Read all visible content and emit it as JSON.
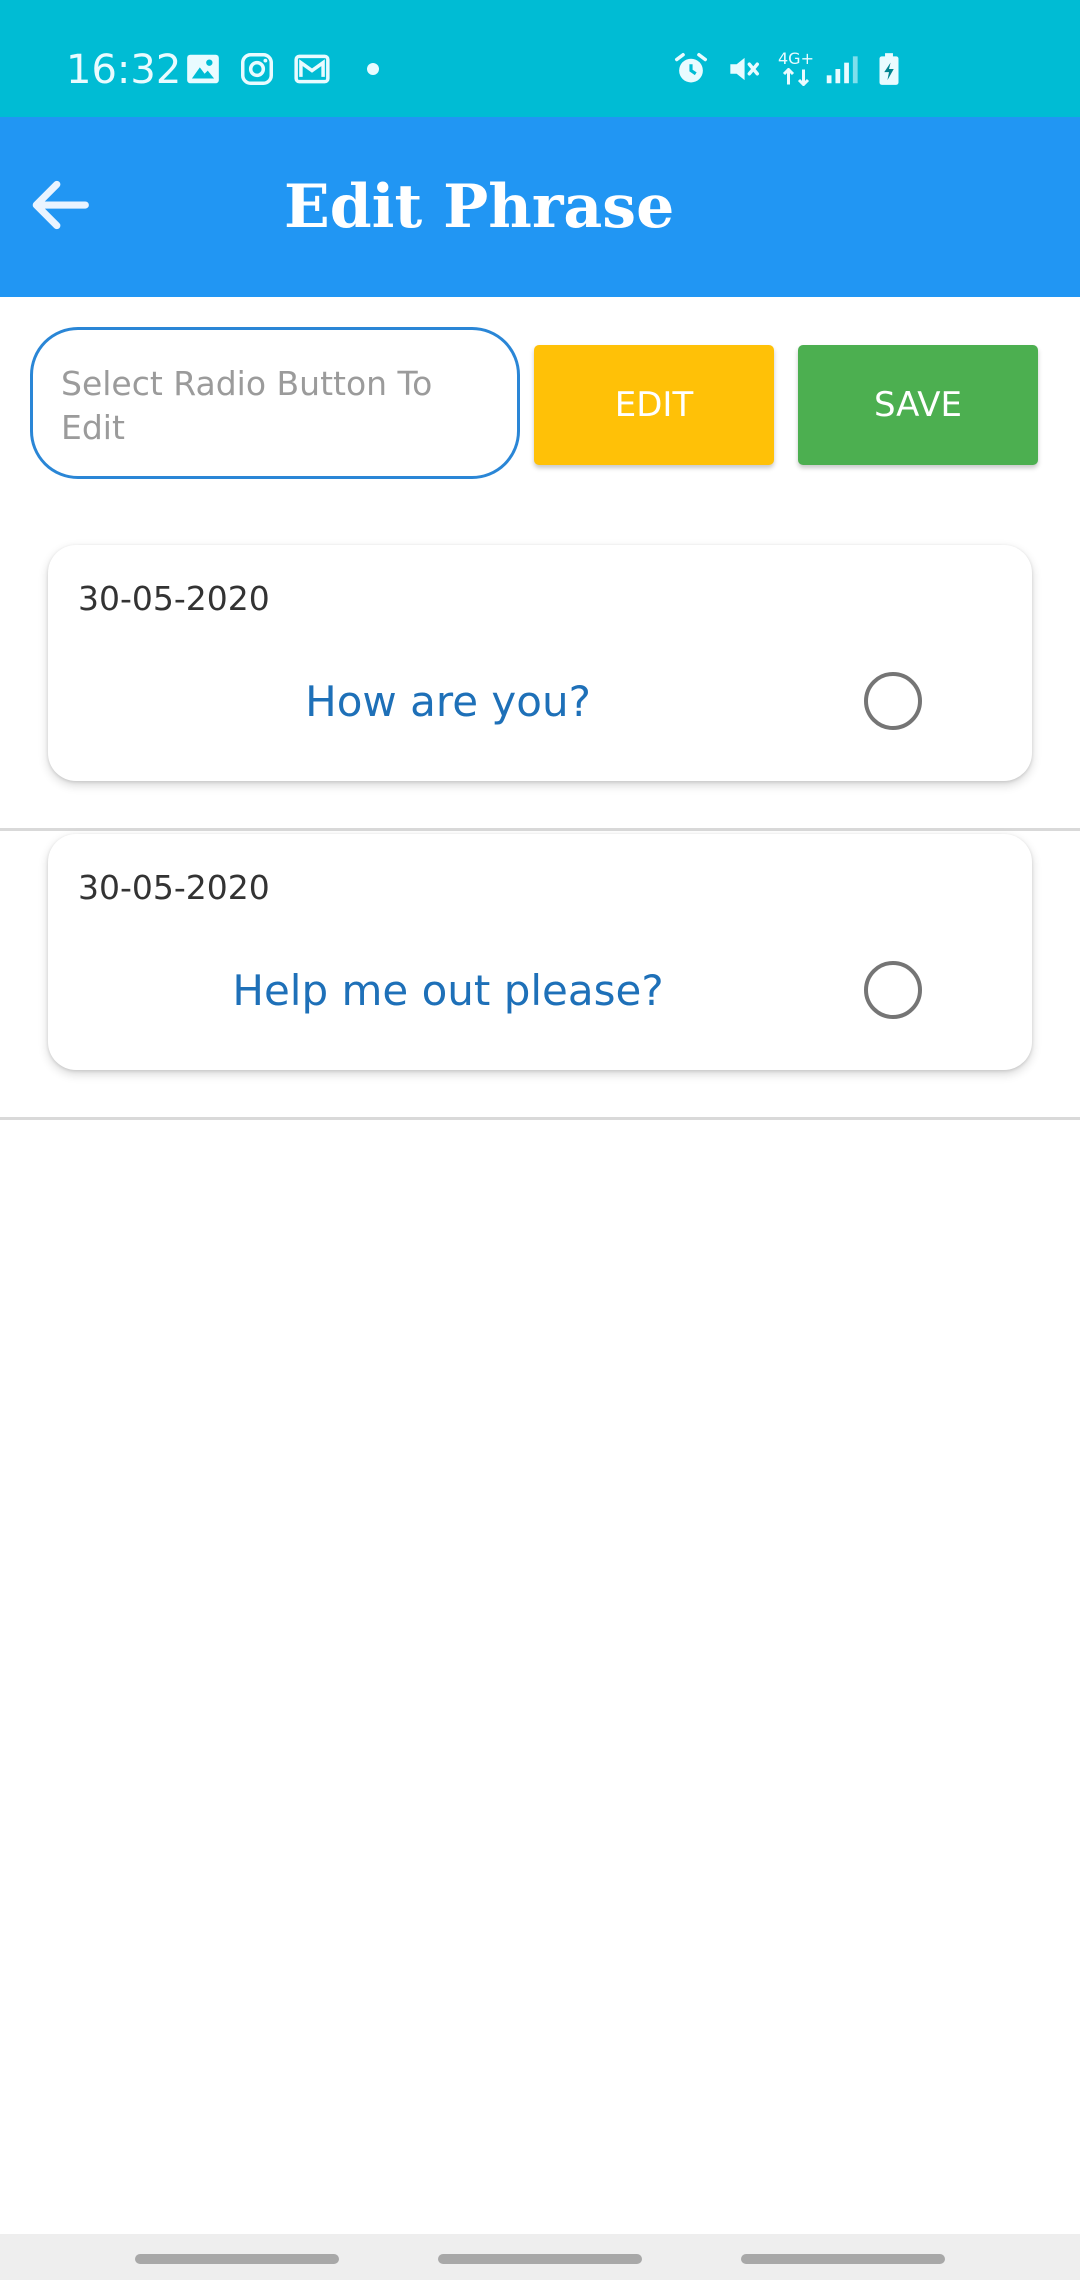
{
  "status_bar": {
    "time": "16:32",
    "left_icons": [
      "image-icon",
      "instagram-icon",
      "gmail-icon",
      "notification-dot"
    ],
    "right_icons": [
      "alarm-icon",
      "vibrate-mute-icon",
      "network-4g-icon",
      "signal-icon",
      "battery-charging-icon"
    ],
    "network_label": "4G+",
    "background_color": "#00bcd4"
  },
  "app_bar": {
    "title": "Edit Phrase",
    "back_icon": "arrow-back-icon",
    "background_color": "#2196f3"
  },
  "controls": {
    "phrase_field": {
      "value": "",
      "placeholder": "Select Radio Button To Edit"
    },
    "edit_label": "EDIT",
    "save_label": "SAVE",
    "edit_color": "#ffc107",
    "save_color": "#4caf50"
  },
  "phrases": [
    {
      "date": "30-05-2020",
      "text": "How are you?",
      "selected": false
    },
    {
      "date": "30-05-2020",
      "text": "Help me out please?",
      "selected": false
    }
  ],
  "colors": {
    "phrase_text": "#1e70b8",
    "input_border": "#2a86d6"
  }
}
